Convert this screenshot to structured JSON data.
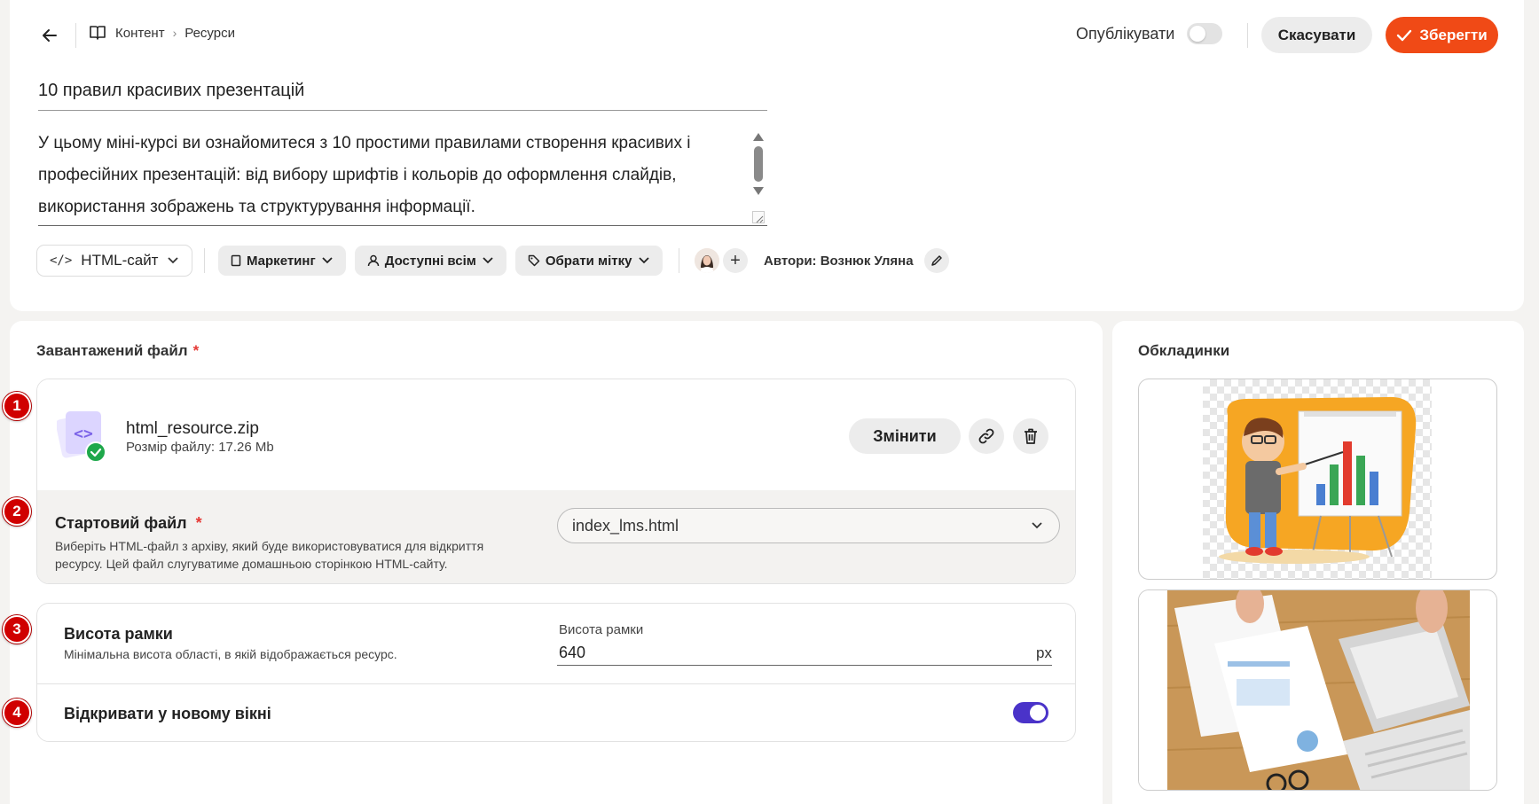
{
  "header": {
    "breadcrumb": [
      "Контент",
      "Ресурси"
    ],
    "publish_label": "Опублікувати",
    "publish_on": false,
    "cancel_label": "Скасувати",
    "save_label": "Зберегти",
    "accent_color": "#f04a16"
  },
  "resource": {
    "title": "10 правил красивих презентацій",
    "description": "У цьому міні-курсі ви ознайомитеся з 10 простими правилами створення красивих і професійних презентацій: від вибору шрифтів і кольорів до оформлення слайдів, використання зображень та структурування інформації.",
    "type_label": "HTML-сайт",
    "category_label": "Маркетинг",
    "access_label": "Доступні всім",
    "tag_label": "Обрати мітку",
    "authors_label": "Автори: Вознюк Уляна"
  },
  "file_section": {
    "title": "Завантажений файл",
    "required_mark": "*",
    "file_name": "html_resource.zip",
    "file_size": "Розмір файлу: 17.26 Mb",
    "change_label": "Змінити",
    "start_file_label": "Стартовий файл",
    "start_file_help": "Виберіть HTML-файл з архіву, який буде використовуватися для відкриття ресурсу. Цей файл слугуватиме домашньою сторінкою HTML-сайту.",
    "start_file_value": "index_lms.html",
    "frame_height_label": "Висота рамки",
    "frame_height_help": "Мінімальна висота області, в якій відображається ресурс.",
    "frame_height_field_label": "Висота рамки",
    "frame_height_value": "640",
    "frame_height_unit": "px",
    "new_window_label": "Відкривати у новому вікні",
    "new_window_on": true,
    "toggle_color": "#4a33c9"
  },
  "covers": {
    "title": "Обкладинки"
  },
  "steps": [
    "1",
    "2",
    "3",
    "4"
  ],
  "step_color": "#d00000"
}
